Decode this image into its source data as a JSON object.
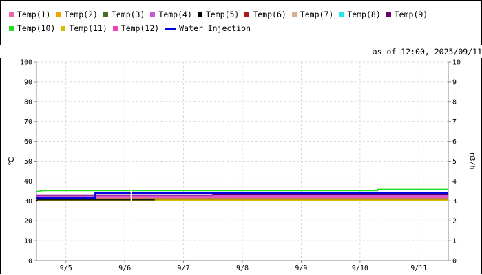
{
  "legend": [
    {
      "name": "Temp(1)",
      "color": "#ee66aa"
    },
    {
      "name": "Temp(2)",
      "color": "#f0a000"
    },
    {
      "name": "Temp(3)",
      "color": "#4a6a28"
    },
    {
      "name": "Temp(4)",
      "color": "#cc55dd"
    },
    {
      "name": "Temp(5)",
      "color": "#000000"
    },
    {
      "name": "Temp(6)",
      "color": "#aa1818"
    },
    {
      "name": "Temp(7)",
      "color": "#d8b090"
    },
    {
      "name": "Temp(8)",
      "color": "#22e8e8"
    },
    {
      "name": "Temp(9)",
      "color": "#6a006a"
    },
    {
      "name": "Temp(10)",
      "color": "#22dd22"
    },
    {
      "name": "Temp(11)",
      "color": "#d4c000"
    },
    {
      "name": "Temp(12)",
      "color": "#ee44bb"
    },
    {
      "name": "Water Injection",
      "color": "#0000dd",
      "style": "line"
    }
  ],
  "asof": "as of 12:00, 2025/09/11",
  "chart_data": {
    "type": "line",
    "title": "",
    "ylabel": "℃",
    "y2label": "m3/h",
    "ylim": [
      0,
      100
    ],
    "y2lim": [
      0,
      10
    ],
    "xlim": [
      4.5,
      11.5
    ],
    "yticks": [
      "0",
      "10",
      "20",
      "30",
      "40",
      "50",
      "60",
      "70",
      "80",
      "90",
      "100"
    ],
    "y2ticks": [
      "0",
      "1",
      "2",
      "3",
      "4",
      "5",
      "6",
      "7",
      "8",
      "9",
      "10"
    ],
    "xticks": [
      {
        "x": 5,
        "label": "9/5"
      },
      {
        "x": 6,
        "label": "9/6"
      },
      {
        "x": 7,
        "label": "9/7"
      },
      {
        "x": 8,
        "label": "9/8"
      },
      {
        "x": 9,
        "label": "9/9"
      },
      {
        "x": 10,
        "label": "9/10"
      },
      {
        "x": 11,
        "label": "9/11"
      }
    ],
    "grid": true,
    "gap": [
      6.1,
      6.12
    ],
    "series": [
      {
        "name": "Temp(10)",
        "color": "#22dd22",
        "axis": "left",
        "points": [
          [
            4.5,
            34.6
          ],
          [
            4.6,
            35.2
          ],
          [
            10.3,
            35.2
          ],
          [
            10.3,
            35.8
          ],
          [
            11.5,
            35.8
          ]
        ]
      },
      {
        "name": "Water Injection",
        "color": "#0000dd",
        "axis": "right",
        "width": 2.5,
        "points": [
          [
            4.5,
            3.15
          ],
          [
            5.5,
            3.15
          ],
          [
            5.5,
            3.4
          ],
          [
            11.5,
            3.4
          ]
        ]
      },
      {
        "name": "Temp(9)",
        "color": "#6a006a",
        "axis": "left",
        "points": [
          [
            4.5,
            33.0
          ],
          [
            7.5,
            33.0
          ],
          [
            7.5,
            33.5
          ],
          [
            11.5,
            33.5
          ]
        ]
      },
      {
        "name": "Temp(4)",
        "color": "#cc55dd",
        "axis": "left",
        "points": [
          [
            4.5,
            32.6
          ],
          [
            11.5,
            32.6
          ]
        ]
      },
      {
        "name": "Temp(8)",
        "color": "#22e8e8",
        "axis": "left",
        "points": [
          [
            4.5,
            32.9
          ],
          [
            11.5,
            32.9
          ]
        ]
      },
      {
        "name": "Temp(1)",
        "color": "#ee66aa",
        "axis": "left",
        "points": [
          [
            4.5,
            32.2
          ],
          [
            11.5,
            32.2
          ]
        ]
      },
      {
        "name": "Temp(12)",
        "color": "#ee44bb",
        "axis": "left",
        "points": [
          [
            4.5,
            31.9
          ],
          [
            11.5,
            31.9
          ]
        ]
      },
      {
        "name": "Temp(7)",
        "color": "#d8b090",
        "axis": "left",
        "points": [
          [
            4.5,
            31.6
          ],
          [
            11.5,
            31.6
          ]
        ]
      },
      {
        "name": "Temp(6)",
        "color": "#aa1818",
        "axis": "left",
        "points": [
          [
            4.5,
            31.3
          ],
          [
            11.5,
            31.3
          ]
        ]
      },
      {
        "name": "Temp(3)",
        "color": "#4a6a28",
        "axis": "left",
        "points": [
          [
            4.5,
            31.0
          ],
          [
            11.5,
            31.0
          ]
        ]
      },
      {
        "name": "Temp(5)",
        "color": "#000000",
        "axis": "left",
        "points": [
          [
            4.5,
            29.8
          ],
          [
            4.52,
            30.6
          ],
          [
            6.5,
            30.6
          ],
          [
            6.5,
            31.1
          ],
          [
            11.5,
            31.1
          ]
        ]
      },
      {
        "name": "Temp(2)",
        "color": "#f0a000",
        "axis": "left",
        "points": [
          [
            4.5,
            30.8
          ],
          [
            11.5,
            30.8
          ]
        ]
      },
      {
        "name": "Temp(11)",
        "color": "#d4c000",
        "axis": "left",
        "points": [
          [
            4.5,
            30.4
          ],
          [
            11.5,
            30.4
          ]
        ]
      }
    ]
  }
}
